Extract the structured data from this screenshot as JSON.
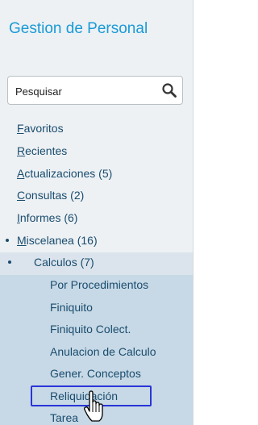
{
  "app": {
    "title": "Gestion de Personal"
  },
  "search": {
    "placeholder": "Pesquisar",
    "icon": "search-icon"
  },
  "nav": {
    "items": [
      {
        "first": "F",
        "rest": "avoritos"
      },
      {
        "first": "R",
        "rest": "ecientes"
      },
      {
        "first": "A",
        "rest": "ctualizaciones (5)"
      },
      {
        "first": "C",
        "rest": "onsultas (2)"
      },
      {
        "first": "I",
        "rest": "nformes (6)"
      },
      {
        "first": "M",
        "rest": "iscelanea (16)"
      }
    ],
    "calculos": "Calculos (7)",
    "sub_items": [
      "Por Procedimientos",
      "Finiquito",
      "Finiquito Colect.",
      "Anulacion de Calculo",
      "Gener. Conceptos",
      "Reliquidación",
      "Tarea"
    ]
  },
  "colors": {
    "title": "#1a9ad6",
    "link": "#1a4c6e",
    "panel_bg": "#edf1f4",
    "submenu_bg": "#c7d9e6",
    "selection_border": "#2a35d8"
  }
}
